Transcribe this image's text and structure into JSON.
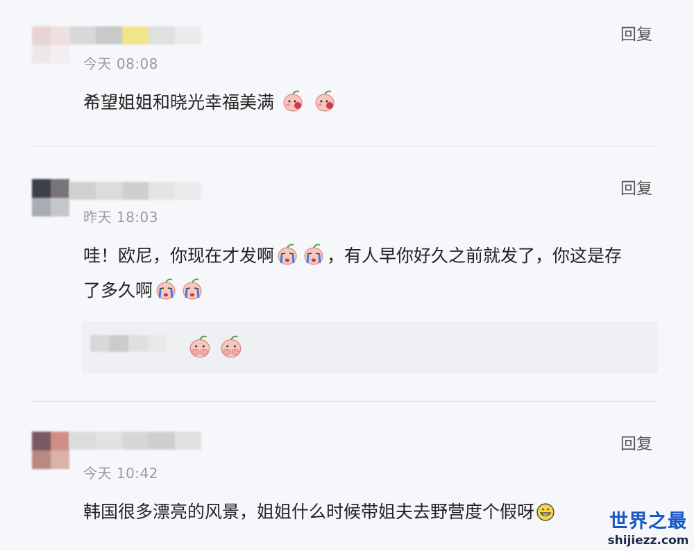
{
  "comments": [
    {
      "time": "今天 08:08",
      "reply_label": "回复",
      "text": "希望姐姐和晓光幸福美满",
      "emoji": "blush-peach-face"
    },
    {
      "time": "昨天 18:03",
      "reply_label": "回复",
      "text_part1": "哇！欧尼，你现在才发啊",
      "text_part2": "，有人早你好久之前就发了，你这是存",
      "text_part3": "了多久啊",
      "emoji": "crying-peach-face",
      "subreply": {
        "emoji": "covering-face-peach"
      }
    },
    {
      "time": "今天 10:42",
      "reply_label": "回复",
      "text": "韩国很多漂亮的风景，姐姐什么时候带姐夫去野营度个假呀",
      "emoji": "grinning-face"
    }
  ],
  "watermark": {
    "title": "世界之最",
    "url": "shijiezz.com",
    "color": "#1656c6"
  }
}
